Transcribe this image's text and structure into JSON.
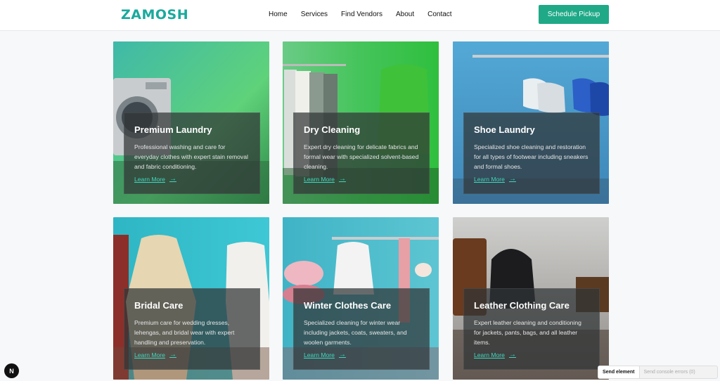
{
  "header": {
    "logo": "ZAMOSH",
    "nav": [
      "Home",
      "Services",
      "Find Vendors",
      "About",
      "Contact"
    ],
    "cta": "Schedule Pickup"
  },
  "cards": [
    {
      "title": "Premium Laundry",
      "desc": "Professional washing and care for everyday clothes with expert stain removal and fabric conditioning.",
      "link": "Learn More"
    },
    {
      "title": "Dry Cleaning",
      "desc": "Expert dry cleaning for delicate fabrics and formal wear with specialized solvent-based cleaning.",
      "link": "Learn More"
    },
    {
      "title": "Shoe Laundry",
      "desc": "Specialized shoe cleaning and restoration for all types of footwear including sneakers and formal shoes.",
      "link": "Learn More"
    },
    {
      "title": "Bridal Care",
      "desc": "Premium care for wedding dresses, lehengas, and bridal wear with expert handling and preservation.",
      "link": "Learn More"
    },
    {
      "title": "Winter Clothes Care",
      "desc": "Specialized cleaning for winter wear including jackets, coats, sweaters, and woolen garments.",
      "link": "Learn More"
    },
    {
      "title": "Leather Clothing Care",
      "desc": "Expert leather cleaning and conditioning for jackets, pants, bags, and all leather items.",
      "link": "Learn More"
    }
  ],
  "devtools": {
    "badge": "N",
    "send_element": "Send element",
    "send_errors": "Send console errors (0)"
  },
  "colors": {
    "brand": "#1aa99d",
    "cta": "#1fa987",
    "link": "#3fd7bf"
  }
}
